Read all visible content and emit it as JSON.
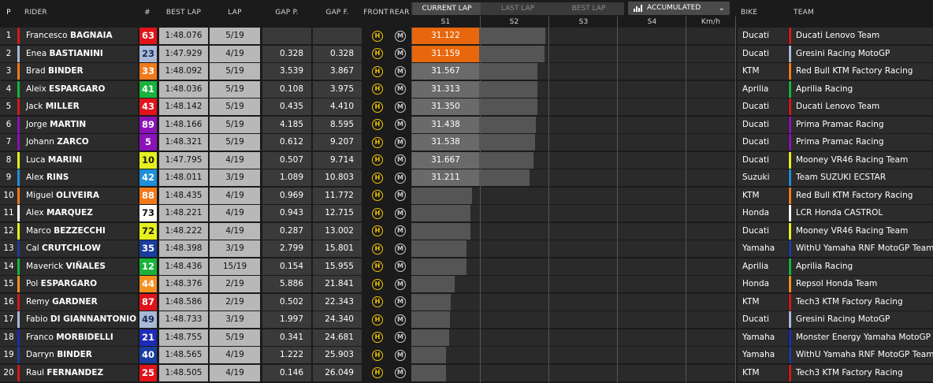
{
  "headers": {
    "p": "P",
    "rider": "RIDER",
    "num": "#",
    "best_lap": "BEST LAP",
    "lap": "LAP",
    "gap_p": "GAP P.",
    "gap_f": "GAP F.",
    "front": "FRONT",
    "rear": "REAR",
    "s1": "S1",
    "s2": "S2",
    "s3": "S3",
    "s4": "S4",
    "kmh": "Km/h",
    "bike": "BIKE",
    "team": "TEAM"
  },
  "lap_tabs": [
    "CURRENT LAP",
    "LAST LAP",
    "BEST LAP"
  ],
  "active_tab": 0,
  "mode_select": {
    "label": "ACCUMULATED",
    "icon": "bar-chart-icon"
  },
  "colors": {
    "sector_fastest": "#e8670c",
    "sector_normal": "#6a6a6a",
    "progress_bar": "#555555",
    "lap_cell_bg": "#b8b8b8",
    "tyre_hard": "#f5c800",
    "tyre_medium": "#cccccc"
  },
  "riders": [
    {
      "pos": "1",
      "first": "Francesco",
      "last": "BAGNAIA",
      "num": "63",
      "num_bg": "#e0131a",
      "num_fg": "#ffffff",
      "best": "1:48.076",
      "lap": "5/19",
      "gap_p": "",
      "gap_f": "",
      "front": "H",
      "rear": "M",
      "s1": "31.122",
      "s1_color": "#e8670c",
      "progress": 0.95,
      "bike": "Ducati",
      "team": "Ducati Lenovo Team",
      "team_color": "#d21a1a"
    },
    {
      "pos": "2",
      "first": "Enea",
      "last": "BASTIANINI",
      "num": "23",
      "num_bg": "#a9b9d6",
      "num_fg": "#1a2a55",
      "best": "1:47.929",
      "lap": "4/19",
      "gap_p": "0.328",
      "gap_f": "0.328",
      "front": "H",
      "rear": "M",
      "s1": "31.159",
      "s1_color": "#e8670c",
      "progress": 0.94,
      "bike": "Ducati",
      "team": "Gresini Racing MotoGP",
      "team_color": "#a9b9d6"
    },
    {
      "pos": "3",
      "first": "Brad",
      "last": "BINDER",
      "num": "33",
      "num_bg": "#f07a1a",
      "num_fg": "#ffffff",
      "best": "1:48.092",
      "lap": "5/19",
      "gap_p": "3.539",
      "gap_f": "3.867",
      "front": "H",
      "rear": "M",
      "s1": "31.567",
      "s1_color": "#6a6a6a",
      "progress": 0.84,
      "bike": "KTM",
      "team": "Red Bull KTM Factory Racing",
      "team_color": "#f07a1a"
    },
    {
      "pos": "4",
      "first": "Aleix",
      "last": "ESPARGARO",
      "num": "41",
      "num_bg": "#19b23b",
      "num_fg": "#ffffff",
      "best": "1:48.036",
      "lap": "5/19",
      "gap_p": "0.108",
      "gap_f": "3.975",
      "front": "H",
      "rear": "M",
      "s1": "31.313",
      "s1_color": "#6a6a6a",
      "progress": 0.84,
      "bike": "Aprilia",
      "team": "Aprilia Racing",
      "team_color": "#19b23b"
    },
    {
      "pos": "5",
      "first": "Jack",
      "last": "MILLER",
      "num": "43",
      "num_bg": "#e0131a",
      "num_fg": "#ffffff",
      "best": "1:48.142",
      "lap": "5/19",
      "gap_p": "0.435",
      "gap_f": "4.410",
      "front": "H",
      "rear": "M",
      "s1": "31.350",
      "s1_color": "#6a6a6a",
      "progress": 0.84,
      "bike": "Ducati",
      "team": "Ducati Lenovo Team",
      "team_color": "#d21a1a"
    },
    {
      "pos": "6",
      "first": "Jorge",
      "last": "MARTIN",
      "num": "89",
      "num_bg": "#8a12b8",
      "num_fg": "#ffffff",
      "best": "1:48.166",
      "lap": "5/19",
      "gap_p": "4.185",
      "gap_f": "8.595",
      "front": "H",
      "rear": "M",
      "s1": "31.438",
      "s1_color": "#6a6a6a",
      "progress": 0.82,
      "bike": "Ducati",
      "team": "Prima Pramac Racing",
      "team_color": "#8a12b8"
    },
    {
      "pos": "7",
      "first": "Johann",
      "last": "ZARCO",
      "num": "5",
      "num_bg": "#8a12b8",
      "num_fg": "#ffffff",
      "best": "1:48.321",
      "lap": "5/19",
      "gap_p": "0.612",
      "gap_f": "9.207",
      "front": "H",
      "rear": "M",
      "s1": "31.538",
      "s1_color": "#6a6a6a",
      "progress": 0.8,
      "bike": "Ducati",
      "team": "Prima Pramac Racing",
      "team_color": "#8a12b8"
    },
    {
      "pos": "8",
      "first": "Luca",
      "last": "MARINI",
      "num": "10",
      "num_bg": "#e6f01e",
      "num_fg": "#1a1a1a",
      "best": "1:47.795",
      "lap": "4/19",
      "gap_p": "0.507",
      "gap_f": "9.714",
      "front": "H",
      "rear": "M",
      "s1": "31.667",
      "s1_color": "#6a6a6a",
      "progress": 0.78,
      "bike": "Ducati",
      "team": "Mooney VR46 Racing Team",
      "team_color": "#e6f01e"
    },
    {
      "pos": "9",
      "first": "Alex",
      "last": "RINS",
      "num": "42",
      "num_bg": "#1e8fd8",
      "num_fg": "#ffffff",
      "best": "1:48.011",
      "lap": "3/19",
      "gap_p": "1.089",
      "gap_f": "10.803",
      "front": "H",
      "rear": "M",
      "s1": "31.211",
      "s1_color": "#6a6a6a",
      "progress": 0.72,
      "bike": "Suzuki",
      "team": "Team SUZUKI ECSTAR",
      "team_color": "#1e8fd8"
    },
    {
      "pos": "10",
      "first": "Miguel",
      "last": "OLIVEIRA",
      "num": "88",
      "num_bg": "#f07a1a",
      "num_fg": "#ffffff",
      "best": "1:48.435",
      "lap": "4/19",
      "gap_p": "0.969",
      "gap_f": "11.772",
      "front": "H",
      "rear": "M",
      "s1": "",
      "s1_color": "",
      "progress": 0.88,
      "bike": "KTM",
      "team": "Red Bull KTM Factory Racing",
      "team_color": "#f07a1a"
    },
    {
      "pos": "11",
      "first": "Alex",
      "last": "MARQUEZ",
      "num": "73",
      "num_bg": "#ffffff",
      "num_fg": "#111111",
      "best": "1:48.221",
      "lap": "4/19",
      "gap_p": "0.943",
      "gap_f": "12.715",
      "front": "H",
      "rear": "M",
      "s1": "",
      "s1_color": "",
      "progress": 0.86,
      "bike": "Honda",
      "team": "LCR Honda CASTROL",
      "team_color": "#ffffff"
    },
    {
      "pos": "12",
      "first": "Marco",
      "last": "BEZZECCHI",
      "num": "72",
      "num_bg": "#e6f01e",
      "num_fg": "#1a1a1a",
      "best": "1:48.222",
      "lap": "4/19",
      "gap_p": "0.287",
      "gap_f": "13.002",
      "front": "H",
      "rear": "M",
      "s1": "",
      "s1_color": "",
      "progress": 0.86,
      "bike": "Ducati",
      "team": "Mooney VR46 Racing Team",
      "team_color": "#e6f01e"
    },
    {
      "pos": "13",
      "first": "Cal",
      "last": "CRUTCHLOW",
      "num": "35",
      "num_bg": "#1a3d9e",
      "num_fg": "#ffffff",
      "best": "1:48.398",
      "lap": "3/19",
      "gap_p": "2.799",
      "gap_f": "15.801",
      "front": "H",
      "rear": "M",
      "s1": "",
      "s1_color": "",
      "progress": 0.8,
      "bike": "Yamaha",
      "team": "WithU Yamaha RNF MotoGP Team",
      "team_color": "#1a3d9e"
    },
    {
      "pos": "14",
      "first": "Maverick",
      "last": "VIÑALES",
      "num": "12",
      "num_bg": "#19b23b",
      "num_fg": "#ffffff",
      "best": "1:48.436",
      "lap": "15/19",
      "gap_p": "0.154",
      "gap_f": "15.955",
      "front": "H",
      "rear": "M",
      "s1": "",
      "s1_color": "",
      "progress": 0.8,
      "bike": "Aprilia",
      "team": "Aprilia Racing",
      "team_color": "#19b23b"
    },
    {
      "pos": "15",
      "first": "Pol",
      "last": "ESPARGARO",
      "num": "44",
      "num_bg": "#f5901e",
      "num_fg": "#ffffff",
      "best": "1:48.376",
      "lap": "2/19",
      "gap_p": "5.886",
      "gap_f": "21.841",
      "front": "H",
      "rear": "M",
      "s1": "",
      "s1_color": "",
      "progress": 0.63,
      "bike": "Honda",
      "team": "Repsol Honda Team",
      "team_color": "#f5901e"
    },
    {
      "pos": "16",
      "first": "Remy",
      "last": "GARDNER",
      "num": "87",
      "num_bg": "#e0131a",
      "num_fg": "#ffffff",
      "best": "1:48.586",
      "lap": "2/19",
      "gap_p": "0.502",
      "gap_f": "22.343",
      "front": "H",
      "rear": "M",
      "s1": "",
      "s1_color": "",
      "progress": 0.58,
      "bike": "KTM",
      "team": "Tech3 KTM Factory Racing",
      "team_color": "#d21a1a"
    },
    {
      "pos": "17",
      "first": "Fabio",
      "last": "DI GIANNANTONIO",
      "num": "49",
      "num_bg": "#a9b9d6",
      "num_fg": "#1a2a55",
      "best": "1:48.733",
      "lap": "3/19",
      "gap_p": "1.997",
      "gap_f": "24.340",
      "front": "H",
      "rear": "M",
      "s1": "",
      "s1_color": "",
      "progress": 0.56,
      "bike": "Ducati",
      "team": "Gresini Racing MotoGP",
      "team_color": "#a9b9d6"
    },
    {
      "pos": "18",
      "first": "Franco",
      "last": "MORBIDELLI",
      "num": "21",
      "num_bg": "#1e2ab8",
      "num_fg": "#ffffff",
      "best": "1:48.755",
      "lap": "5/19",
      "gap_p": "0.341",
      "gap_f": "24.681",
      "front": "H",
      "rear": "M",
      "s1": "",
      "s1_color": "",
      "progress": 0.55,
      "bike": "Yamaha",
      "team": "Monster Energy Yamaha MotoGP",
      "team_color": "#1e2ab8"
    },
    {
      "pos": "19",
      "first": "Darryn",
      "last": "BINDER",
      "num": "40",
      "num_bg": "#1a3d9e",
      "num_fg": "#ffffff",
      "best": "1:48.565",
      "lap": "4/19",
      "gap_p": "1.222",
      "gap_f": "25.903",
      "front": "H",
      "rear": "M",
      "s1": "",
      "s1_color": "",
      "progress": 0.5,
      "bike": "Yamaha",
      "team": "WithU Yamaha RNF MotoGP Team",
      "team_color": "#1a3d9e"
    },
    {
      "pos": "20",
      "first": "Raul",
      "last": "FERNANDEZ",
      "num": "25",
      "num_bg": "#e0131a",
      "num_fg": "#ffffff",
      "best": "1:48.505",
      "lap": "4/19",
      "gap_p": "0.146",
      "gap_f": "26.049",
      "front": "H",
      "rear": "M",
      "s1": "",
      "s1_color": "",
      "progress": 0.5,
      "bike": "KTM",
      "team": "Tech3 KTM Factory Racing",
      "team_color": "#d21a1a"
    }
  ]
}
